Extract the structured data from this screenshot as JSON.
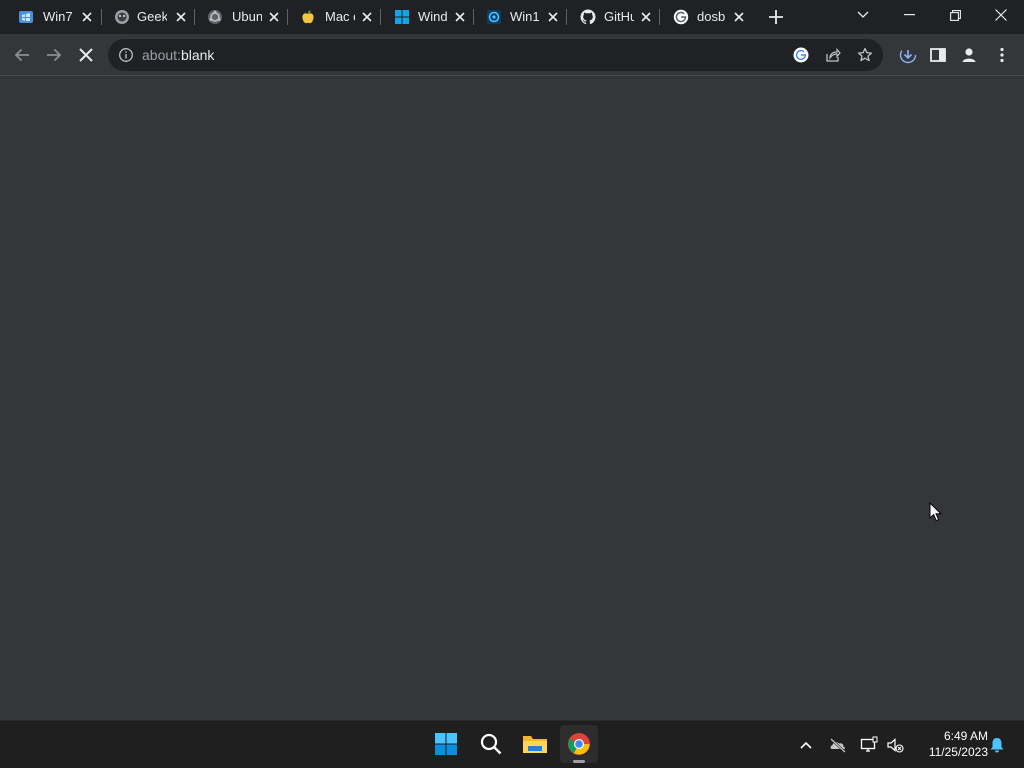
{
  "tabs": [
    {
      "title": "Win7",
      "icon": "win7-favicon"
    },
    {
      "title": "Geek",
      "icon": "geek-favicon"
    },
    {
      "title": "Ubun",
      "icon": "ubuntu-favicon"
    },
    {
      "title": "Mac c",
      "icon": "apple-favicon"
    },
    {
      "title": "Wind",
      "icon": "windows-favicon"
    },
    {
      "title": "Win1",
      "icon": "win11-favicon"
    },
    {
      "title": "GitHu",
      "icon": "github-favicon"
    },
    {
      "title": "dosb",
      "icon": "google-favicon"
    }
  ],
  "toolbar": {
    "url_scheme": "about:",
    "url_host": "blank"
  },
  "taskbar": {
    "time": "6:49 AM",
    "date": "11/25/2023"
  },
  "colors": {
    "tabstrip": "#202124",
    "toolbar": "#35363a",
    "omnibox": "#202124",
    "taskbar": "#1f1f1f",
    "accent": "#8ab4f8"
  }
}
